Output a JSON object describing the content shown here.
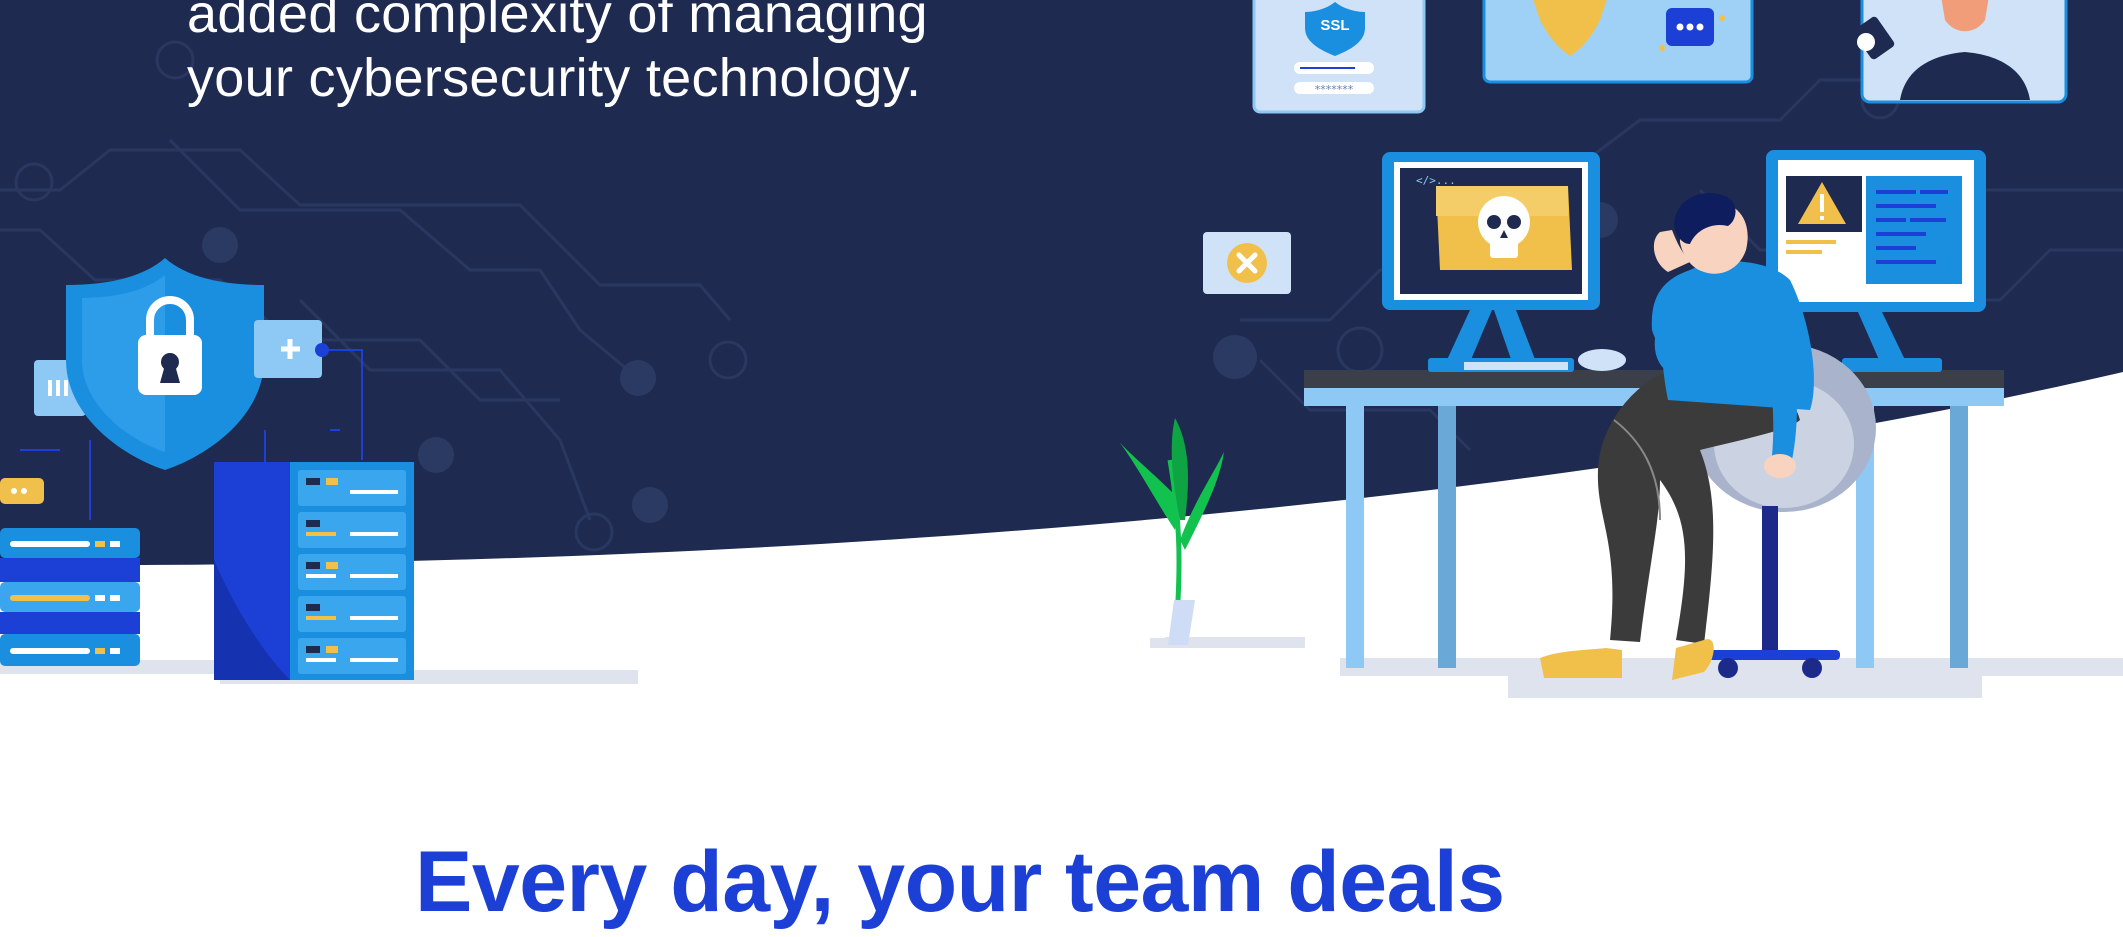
{
  "hero": {
    "line1": "added complexity of managing",
    "line2": "your cybersecurity technology.",
    "ssl_label": "SSL",
    "password_mask": "*******"
  },
  "section": {
    "headline": "Every day, your team deals"
  },
  "colors": {
    "navy": "#1e2a4f",
    "accent_blue": "#1c3fd6",
    "sky_blue": "#1a8fe0",
    "yellow": "#f1c04a",
    "white": "#ffffff"
  },
  "icons": [
    "shield-lock-icon",
    "server-rack-icon",
    "ssl-badge-icon",
    "alert-icon",
    "skull-icon",
    "close-icon",
    "plant-icon"
  ]
}
